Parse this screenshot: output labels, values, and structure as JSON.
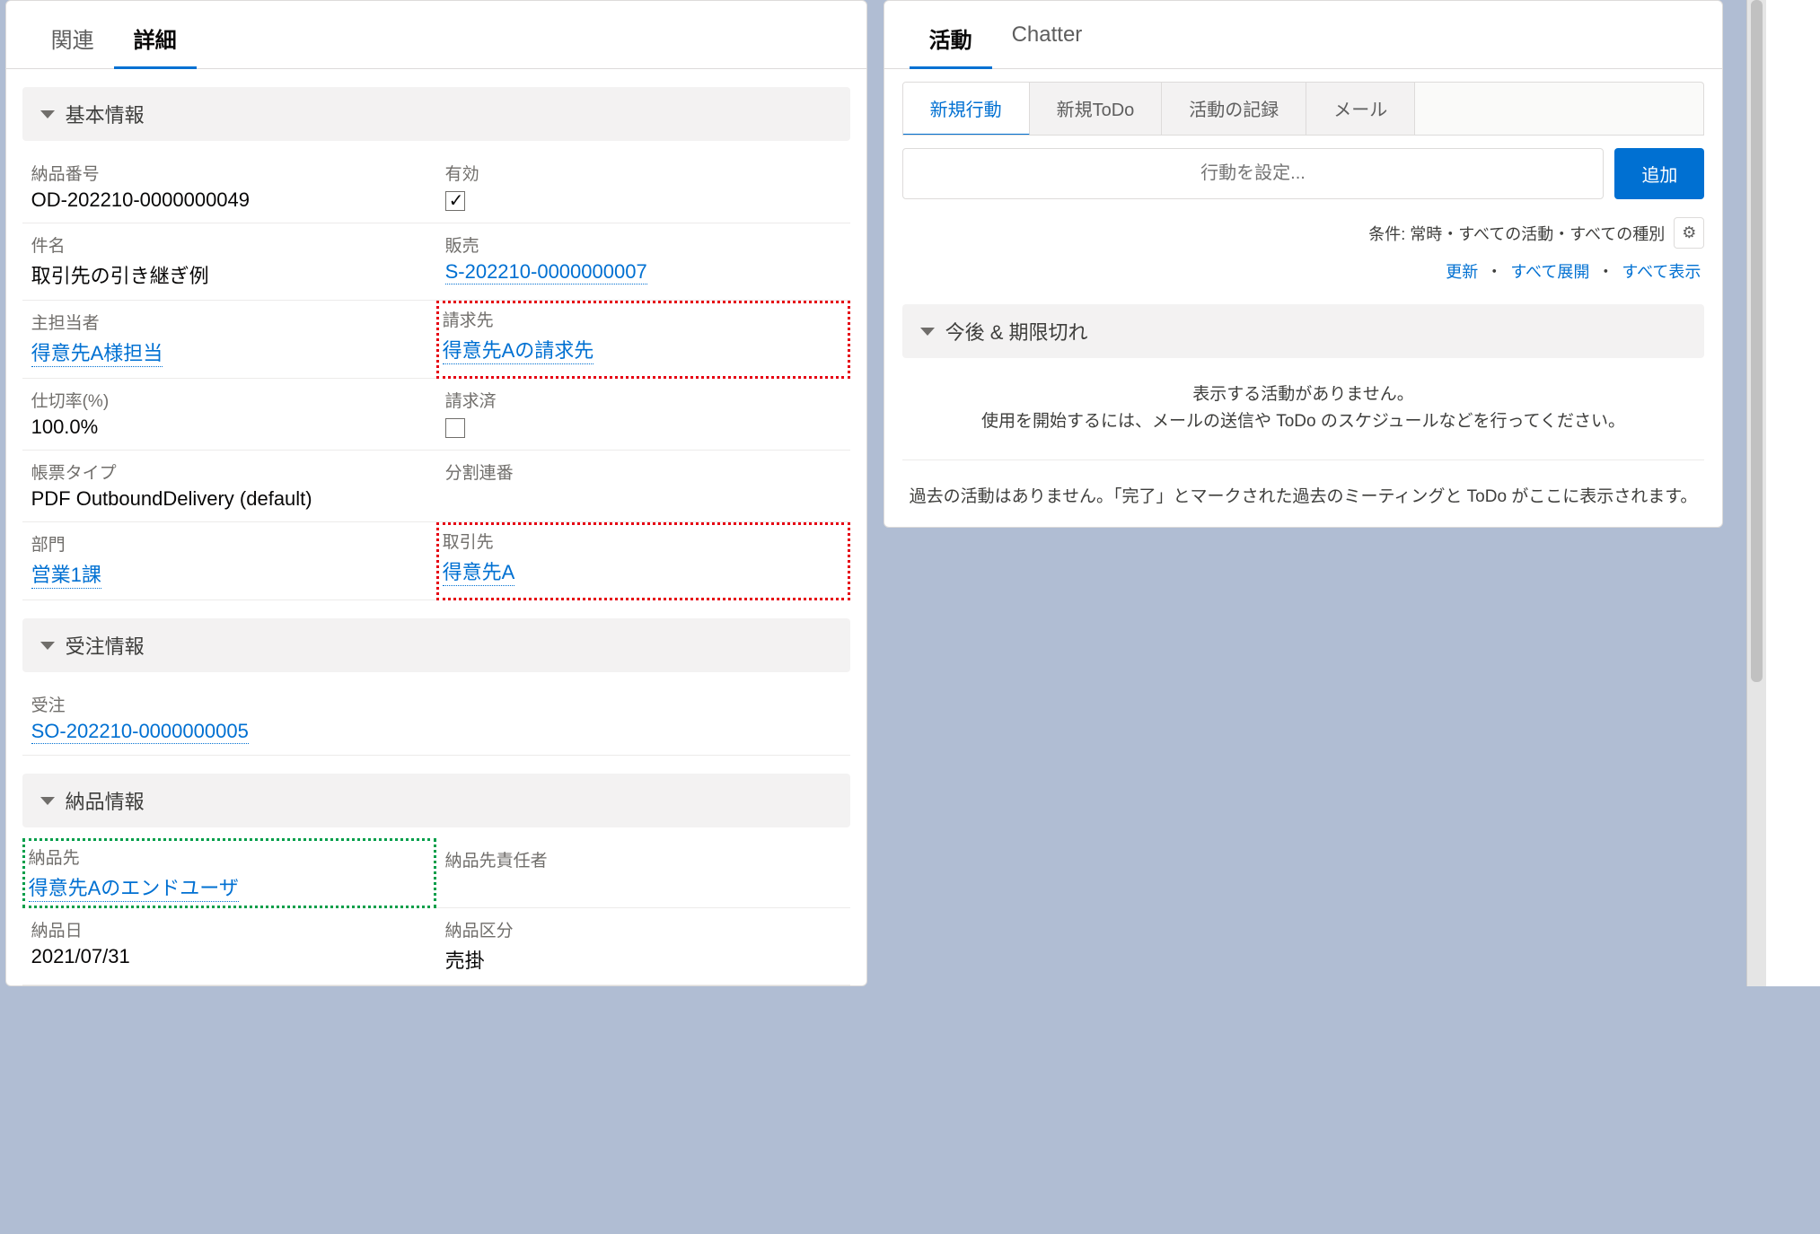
{
  "leftTabs": {
    "related": "関連",
    "details": "詳細"
  },
  "sections": {
    "basic": "基本情報",
    "order": "受注情報",
    "delivery": "納品情報"
  },
  "fields": {
    "deliveryNo": {
      "label": "納品番号",
      "value": "OD-202210-0000000049"
    },
    "valid": {
      "label": "有効"
    },
    "subject": {
      "label": "件名",
      "value": "取引先の引き継ぎ例"
    },
    "sales": {
      "label": "販売",
      "value": "S-202210-0000000007"
    },
    "owner": {
      "label": "主担当者",
      "value": "得意先A様担当"
    },
    "billTo": {
      "label": "請求先",
      "value": "得意先Aの請求先"
    },
    "rate": {
      "label": "仕切率(%)",
      "value": "100.0%"
    },
    "billed": {
      "label": "請求済"
    },
    "formType": {
      "label": "帳票タイプ",
      "value": "PDF OutboundDelivery (default)"
    },
    "splitSeq": {
      "label": "分割連番",
      "value": ""
    },
    "dept": {
      "label": "部門",
      "value": "営業1課"
    },
    "account": {
      "label": "取引先",
      "value": "得意先A"
    },
    "salesOrder": {
      "label": "受注",
      "value": "SO-202210-0000000005"
    },
    "shipTo": {
      "label": "納品先",
      "value": "得意先Aのエンドユーザ"
    },
    "shipToResp": {
      "label": "納品先責任者",
      "value": ""
    },
    "deliveryDate": {
      "label": "納品日",
      "value": "2021/07/31"
    },
    "deliveryType": {
      "label": "納品区分",
      "value": "売掛"
    }
  },
  "rightTabs": {
    "activity": "活動",
    "chatter": "Chatter"
  },
  "activitySubTabs": {
    "newEvent": "新規行動",
    "newTodo": "新規ToDo",
    "logCall": "活動の記録",
    "email": "メール"
  },
  "actionInput": {
    "placeholder": "行動を設定..."
  },
  "addBtn": "追加",
  "filterText": "条件: 常時・すべての活動・すべての種別",
  "links": {
    "refresh": "更新",
    "expandAll": "すべて展開",
    "viewAll": "すべて表示"
  },
  "upcoming": "今後 & 期限切れ",
  "emptyUpcoming1": "表示する活動がありません。",
  "emptyUpcoming2": "使用を開始するには、メールの送信や ToDo のスケジュールなどを行ってください。",
  "emptyPast": "過去の活動はありません。「完了」とマークされた過去のミーティングと ToDo がここに表示されます。"
}
